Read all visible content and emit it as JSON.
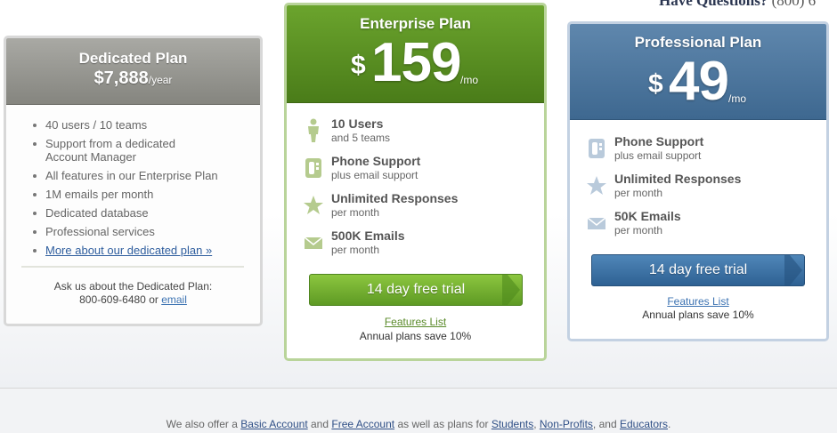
{
  "top_right": {
    "question": "Have Questions?",
    "phone": "(800) 6"
  },
  "dedicated": {
    "name": "Dedicated Plan",
    "price": "$7,888",
    "period": "/year",
    "features": [
      "40 users / 10 teams",
      "Support from a dedicated Account Manager",
      "All features in our Enterprise Plan",
      "1M emails per month",
      "Dedicated database",
      "Professional services"
    ],
    "more_link": "More about our dedicated plan »",
    "ask_text": "Ask us about the Dedicated Plan:",
    "phone": "800-609-6480",
    "or_text": "or",
    "email_link": "email"
  },
  "enterprise": {
    "name": "Enterprise Plan",
    "currency": "$",
    "amount": "159",
    "period": "/mo",
    "features": [
      {
        "icon": "person-icon",
        "title": "10 Users",
        "sub": "and 5 teams"
      },
      {
        "icon": "phone-icon",
        "title": "Phone Support",
        "sub": "plus email support"
      },
      {
        "icon": "star-icon",
        "title": "Unlimited Responses",
        "sub": "per month"
      },
      {
        "icon": "envelope-icon",
        "title": "500K Emails",
        "sub": "per month"
      }
    ],
    "trial_button": "14 day free trial",
    "features_link": "Features List",
    "save_text": "Annual plans save 10%"
  },
  "professional": {
    "name": "Professional Plan",
    "currency": "$",
    "amount": "49",
    "period": "/mo",
    "features": [
      {
        "icon": "phone-icon",
        "title": "Phone Support",
        "sub": "plus email support"
      },
      {
        "icon": "star-icon",
        "title": "Unlimited Responses",
        "sub": "per month"
      },
      {
        "icon": "envelope-icon",
        "title": "50K Emails",
        "sub": "per month"
      }
    ],
    "trial_button": "14 day free trial",
    "features_link": "Features List",
    "save_text": "Annual plans save 10%"
  },
  "footer": {
    "t1": "We also offer a",
    "basic": "Basic Account",
    "t2": "and",
    "free": "Free Account",
    "t3": "as well as plans for",
    "students": "Students",
    "t4": ",",
    "nonprofits": "Non-Profits",
    "t5": ", and",
    "educators": "Educators",
    "t6": "."
  },
  "colors": {
    "enterprise_green": "#5e9a24",
    "professional_blue": "#3e6890",
    "dedicated_gray": "#95958f",
    "link_blue": "#2f5e9e"
  }
}
